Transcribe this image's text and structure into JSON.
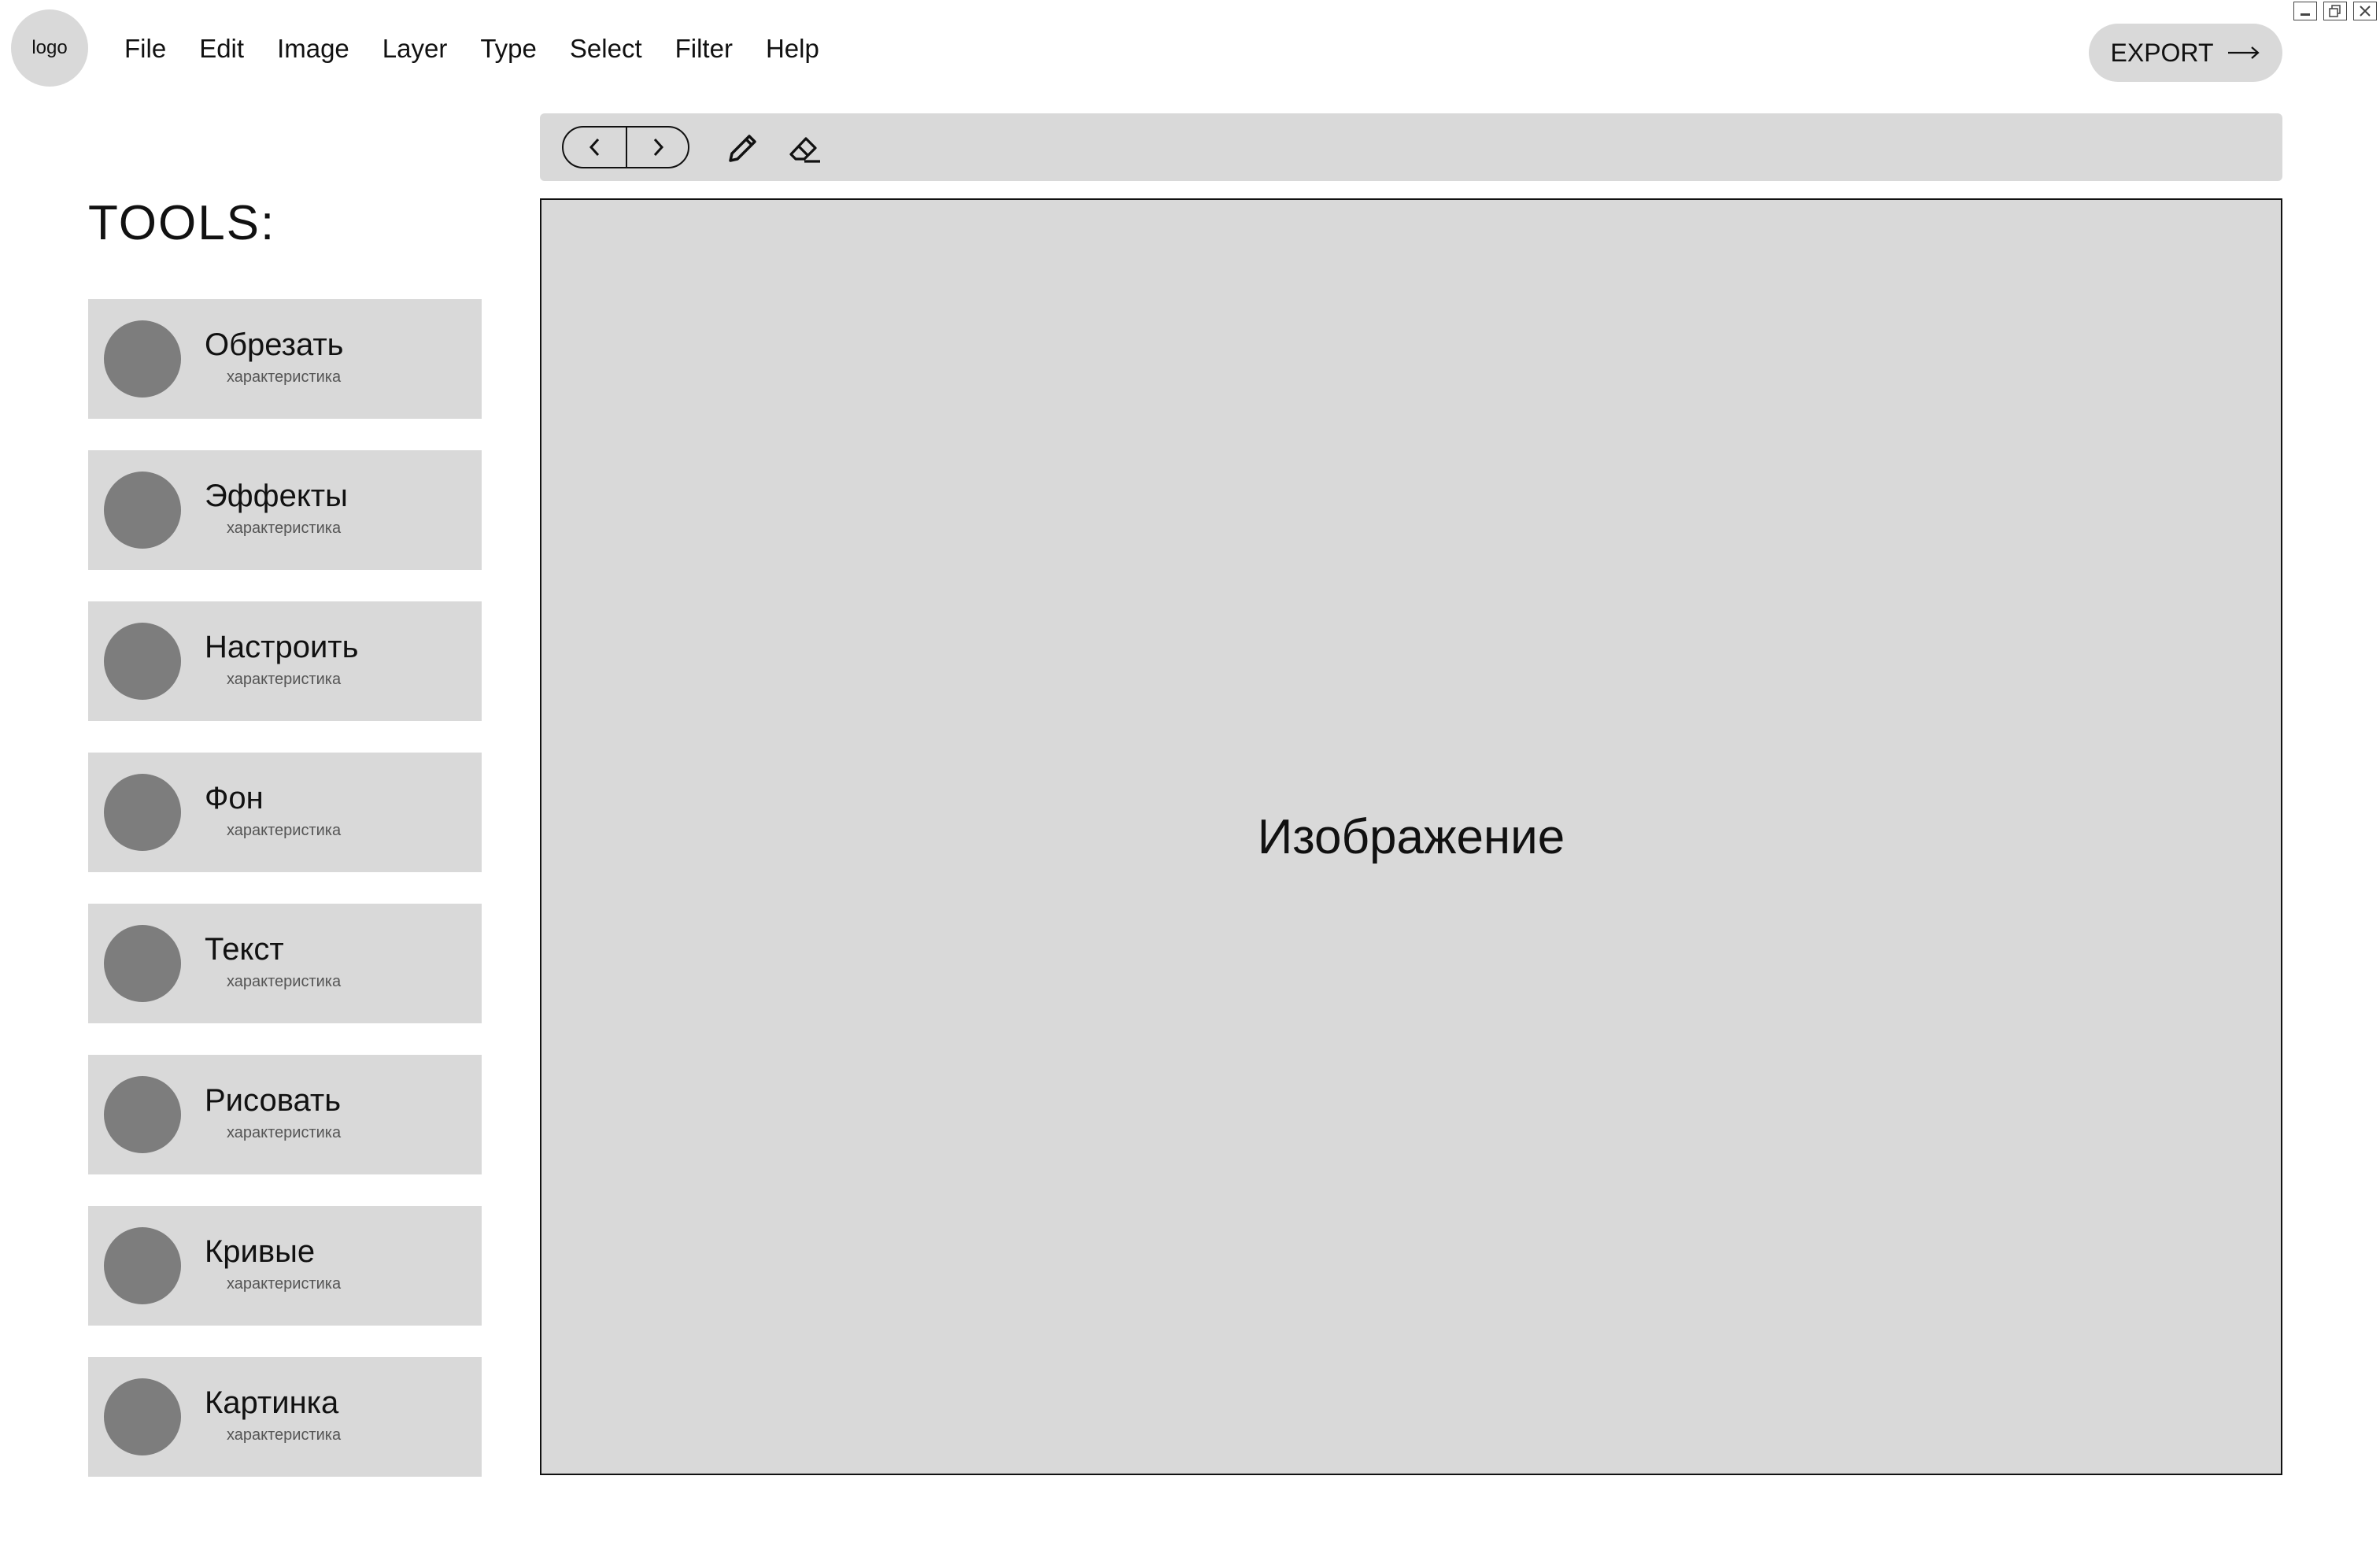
{
  "app": {
    "logo_text": "logo",
    "menu": [
      "File",
      "Edit",
      "Image",
      "Layer",
      "Type",
      "Select",
      "Filter",
      "Help"
    ],
    "export_label": "EXPORT"
  },
  "toolbar": {
    "icons": [
      "back-icon",
      "forward-icon",
      "pencil-icon",
      "eraser-icon"
    ]
  },
  "sidebar": {
    "title": "TOOLS:",
    "items": [
      {
        "label": "Обрезать",
        "sub": "характеристика"
      },
      {
        "label": "Эффекты",
        "sub": "характеристика"
      },
      {
        "label": "Настроить",
        "sub": "характеристика"
      },
      {
        "label": "Фон",
        "sub": "характеристика"
      },
      {
        "label": "Текст",
        "sub": "характеристика"
      },
      {
        "label": "Рисовать",
        "sub": "характеристика"
      },
      {
        "label": "Кривые",
        "sub": "характеристика"
      },
      {
        "label": "Картинка",
        "sub": "характеристика"
      }
    ]
  },
  "canvas": {
    "label": "Изображение"
  },
  "colors": {
    "panel": "#d9d9d9",
    "dot": "#7d7d7d",
    "text": "#111111"
  }
}
